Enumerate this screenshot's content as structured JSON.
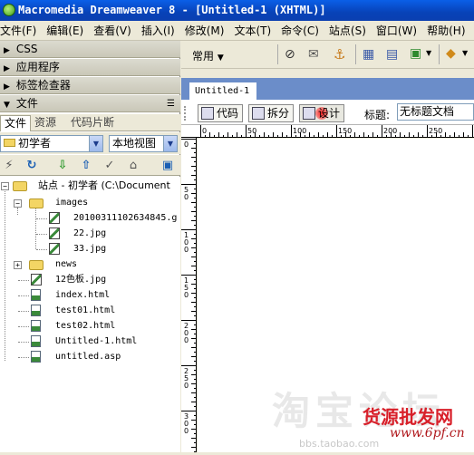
{
  "window": {
    "title": "Macromedia Dreamweaver 8 - [Untitled-1 (XHTML)]"
  },
  "menu": [
    "文件(F)",
    "编辑(E)",
    "查看(V)",
    "插入(I)",
    "修改(M)",
    "文本(T)",
    "命令(C)",
    "站点(S)",
    "窗口(W)",
    "帮助(H)"
  ],
  "panels": {
    "css": "CSS",
    "app": "应用程序",
    "tag": "标签检查器",
    "files": "文件"
  },
  "file_tabs": [
    "文件",
    "资源",
    "代码片断"
  ],
  "site_select": "初学者",
  "view_select": "本地视图",
  "tree": {
    "root": "站点 - 初学者 (C:\\Document",
    "images": "images",
    "img1": "20100311102634845.g",
    "img2": "22.jpg",
    "img3": "33.jpg",
    "news": "news",
    "f1": "12色板.jpg",
    "f2": "index.html",
    "f3": "test01.html",
    "f4": "test02.html",
    "f5": "Untitled-1.html",
    "f6": "untitled.asp"
  },
  "insertbar": {
    "category": "常用"
  },
  "document": {
    "tab": "Untitled-1",
    "code_btn": "代码",
    "split_btn": "拆分",
    "design_btn": "设计",
    "title_label": "标题:",
    "title_value": "无标题文档"
  },
  "ruler": {
    "h_labels": [
      "0",
      "50",
      "100",
      "150",
      "200",
      "250"
    ],
    "v_labels": [
      "0",
      "50",
      "100",
      "150",
      "200",
      "250",
      "300"
    ]
  },
  "watermark": {
    "site": "bbs.taobao.com",
    "brand": "货源批发网",
    "url": "www.6pf.cn"
  }
}
